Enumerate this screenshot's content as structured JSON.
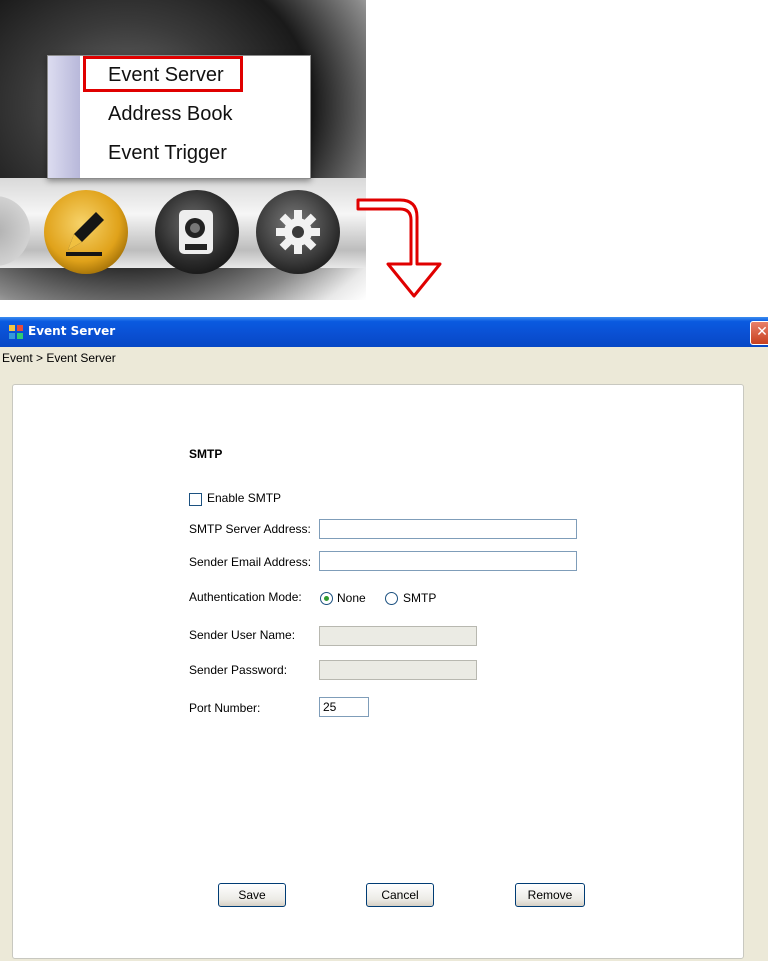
{
  "menu": {
    "items": [
      "Event Server",
      "Address Book",
      "Event Trigger"
    ]
  },
  "window": {
    "title": "Event Server",
    "breadcrumb": "Event > Event Server"
  },
  "form": {
    "section_title": "SMTP",
    "enable_smtp_label": "Enable SMTP",
    "enable_smtp_checked": false,
    "smtp_server_label": "SMTP Server Address:",
    "smtp_server_value": "",
    "sender_email_label": "Sender Email Address:",
    "sender_email_value": "",
    "auth_mode_label": "Authentication Mode:",
    "auth_options": [
      "None",
      "SMTP"
    ],
    "auth_selected": "None",
    "sender_user_label": "Sender User Name:",
    "sender_user_value": "",
    "sender_password_label": "Sender Password:",
    "sender_password_value": "",
    "port_label": "Port Number:",
    "port_value": "25"
  },
  "buttons": {
    "save": "Save",
    "cancel": "Cancel",
    "remove": "Remove"
  },
  "colors": {
    "highlight_box": "#e00000",
    "arrow": "#e00000",
    "titlebar": "#0a4fd2",
    "window_bg": "#ece9d8"
  }
}
